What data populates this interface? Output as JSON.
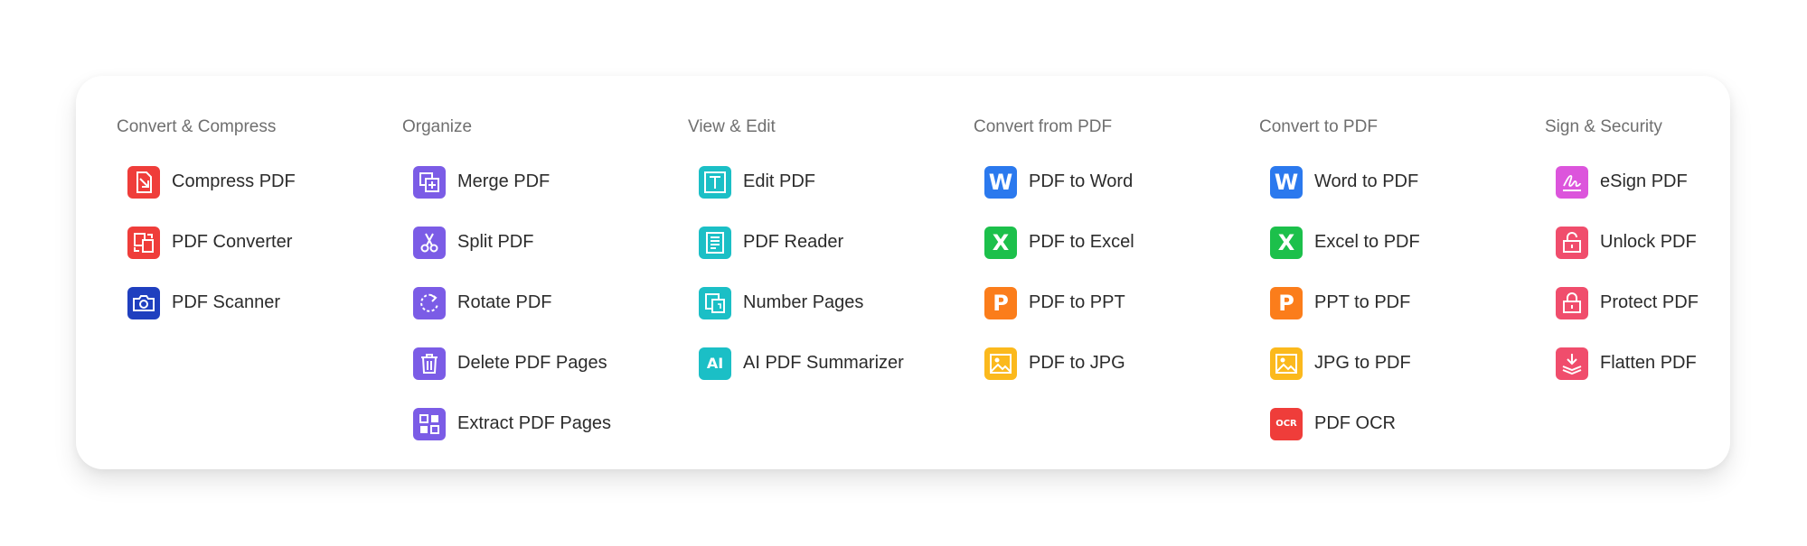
{
  "colors": {
    "red": "#ef3d3a",
    "navy": "#1f3fbf",
    "purple": "#7b5ce6",
    "teal": "#1bbfc6",
    "word_blue": "#2b79ee",
    "excel_green": "#1cc04b",
    "ppt_orange": "#fb7d1b",
    "jpg_yellow": "#fbb91d",
    "esign_magenta": "#dc55dc",
    "security_pink": "#f04d6c"
  },
  "columns": [
    {
      "title": "Convert & Compress",
      "items": [
        {
          "label": "Compress PDF",
          "icon": "compress-icon"
        },
        {
          "label": "PDF Converter",
          "icon": "convert-icon"
        },
        {
          "label": "PDF Scanner",
          "icon": "camera-icon"
        }
      ]
    },
    {
      "title": "Organize",
      "items": [
        {
          "label": "Merge PDF",
          "icon": "merge-icon"
        },
        {
          "label": "Split PDF",
          "icon": "scissors-icon"
        },
        {
          "label": "Rotate PDF",
          "icon": "rotate-icon"
        },
        {
          "label": "Delete PDF Pages",
          "icon": "trash-icon"
        },
        {
          "label": "Extract PDF Pages",
          "icon": "grid-icon"
        }
      ]
    },
    {
      "title": "View & Edit",
      "items": [
        {
          "label": "Edit PDF",
          "icon": "text-icon"
        },
        {
          "label": "PDF Reader",
          "icon": "document-icon"
        },
        {
          "label": "Number Pages",
          "icon": "number-pages-icon"
        },
        {
          "label": "AI PDF Summarizer",
          "icon": "ai-icon",
          "glyph": "AI"
        }
      ]
    },
    {
      "title": "Convert from PDF",
      "items": [
        {
          "label": "PDF to Word",
          "icon": "word-icon",
          "glyph": "W"
        },
        {
          "label": "PDF to Excel",
          "icon": "excel-icon",
          "glyph": "X"
        },
        {
          "label": "PDF to PPT",
          "icon": "ppt-icon",
          "glyph": "P"
        },
        {
          "label": "PDF to JPG",
          "icon": "image-icon"
        }
      ]
    },
    {
      "title": "Convert to PDF",
      "items": [
        {
          "label": "Word to PDF",
          "icon": "word-icon",
          "glyph": "W"
        },
        {
          "label": "Excel to PDF",
          "icon": "excel-icon",
          "glyph": "X"
        },
        {
          "label": "PPT to PDF",
          "icon": "ppt-icon",
          "glyph": "P"
        },
        {
          "label": "JPG to PDF",
          "icon": "image-icon"
        },
        {
          "label": "PDF OCR",
          "icon": "ocr-icon",
          "glyph": "OCR"
        }
      ]
    },
    {
      "title": "Sign & Security",
      "items": [
        {
          "label": "eSign PDF",
          "icon": "signature-icon"
        },
        {
          "label": "Unlock PDF",
          "icon": "unlock-icon"
        },
        {
          "label": "Protect PDF",
          "icon": "lock-icon"
        },
        {
          "label": "Flatten PDF",
          "icon": "flatten-icon"
        }
      ]
    }
  ]
}
